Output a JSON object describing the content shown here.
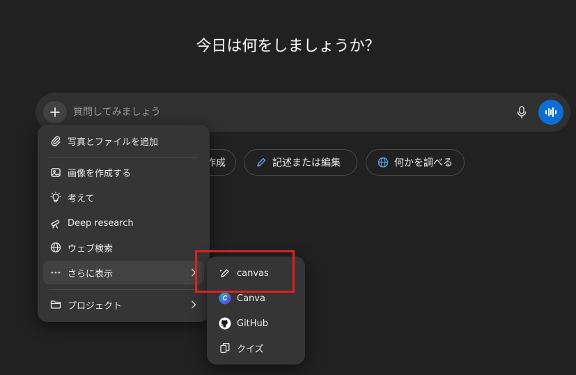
{
  "headline": "今日は何をしましょうか？",
  "composer": {
    "placeholder": "質問してみましょう",
    "plus_icon": "plus-icon",
    "mic_icon": "microphone-icon",
    "voice_icon": "voice-waveform-icon",
    "voice_color": "#0d6fd6"
  },
  "chips": [
    {
      "label": "作成",
      "icon": "image-icon"
    },
    {
      "label": "記述または編集",
      "icon": "pencil-icon"
    },
    {
      "label": "何かを調べる",
      "icon": "globe-icon"
    }
  ],
  "menu": {
    "items": [
      {
        "label": "写真とファイルを追加",
        "icon": "paperclip-icon"
      },
      {
        "label": "画像を作成する",
        "icon": "image-create-icon"
      },
      {
        "label": "考えて",
        "icon": "lightbulb-icon"
      },
      {
        "label": "Deep research",
        "icon": "telescope-icon"
      },
      {
        "label": "ウェブ検索",
        "icon": "globe-icon"
      },
      {
        "label": "さらに表示",
        "icon": "more-dots-icon",
        "has_submenu": true
      },
      {
        "label": "プロジェクト",
        "icon": "folder-icon",
        "has_submenu": true
      }
    ]
  },
  "submenu": {
    "items": [
      {
        "label": "canvas",
        "icon": "canvas-pen-icon"
      },
      {
        "label": "Canva",
        "icon": "canva-logo-icon"
      },
      {
        "label": "GitHub",
        "icon": "github-logo-icon"
      },
      {
        "label": "クイズ",
        "icon": "quiz-cards-icon"
      }
    ]
  },
  "colors": {
    "background": "#212121",
    "menu": "#353535",
    "highlight_border": "#e0201c",
    "canva_blue": "#7d2ae8"
  }
}
